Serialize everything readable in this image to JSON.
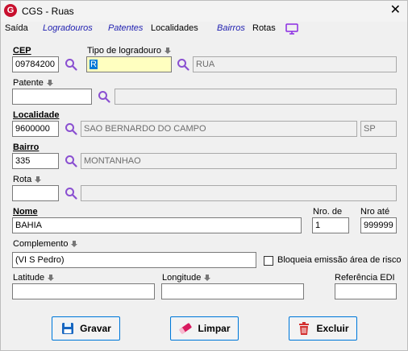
{
  "window": {
    "logo_letter": "G",
    "title": "CGS - Ruas",
    "close_glyph": "✕"
  },
  "menu": {
    "items": [
      {
        "label": "Saída",
        "style": "plain"
      },
      {
        "label": "Logradouros",
        "style": "link"
      },
      {
        "label": "Patentes",
        "style": "link"
      },
      {
        "label": "Localidades",
        "style": "plain"
      },
      {
        "label": "Bairros",
        "style": "link"
      },
      {
        "label": "Rotas",
        "style": "plain"
      }
    ],
    "monitor_icon": "monitor-icon"
  },
  "form": {
    "cep": {
      "label": "CEP",
      "value": "09784200"
    },
    "tipo_logradouro": {
      "label": "Tipo de logradouro",
      "code": "R",
      "description": "RUA"
    },
    "patente": {
      "label": "Patente",
      "code": "",
      "description": ""
    },
    "localidade": {
      "label": "Localidade",
      "code": "9600000",
      "description": "SAO BERNARDO DO CAMPO",
      "uf": "SP"
    },
    "bairro": {
      "label": "Bairro",
      "code": "335",
      "description": "MONTANHAO"
    },
    "rota": {
      "label": "Rota",
      "code": "",
      "description": ""
    },
    "nome": {
      "label": "Nome",
      "value": "BAHIA"
    },
    "nro_de": {
      "label": "Nro. de",
      "value": "1"
    },
    "nro_ate": {
      "label": "Nro até",
      "value": "999999"
    },
    "complemento": {
      "label": "Complemento",
      "value": "(VI S Pedro)"
    },
    "bloqueia": {
      "label": "Bloqueia emissão área de risco",
      "checked": false
    },
    "latitude": {
      "label": "Latitude",
      "value": ""
    },
    "longitude": {
      "label": "Longitude",
      "value": ""
    },
    "referencia_edi": {
      "label": "Referência EDI",
      "value": ""
    }
  },
  "buttons": {
    "gravar": "Gravar",
    "limpar": "Limpar",
    "excluir": "Excluir"
  },
  "colors": {
    "accent": "#0078d7",
    "link": "#1f1fb0",
    "search_icon": "#8a4fd1",
    "highlight_field": "#ffffc0",
    "logo": "#c8102e",
    "delete_icon": "#d32f2f",
    "clear_icon": "#d81b60",
    "save_icon": "#1565c0"
  }
}
